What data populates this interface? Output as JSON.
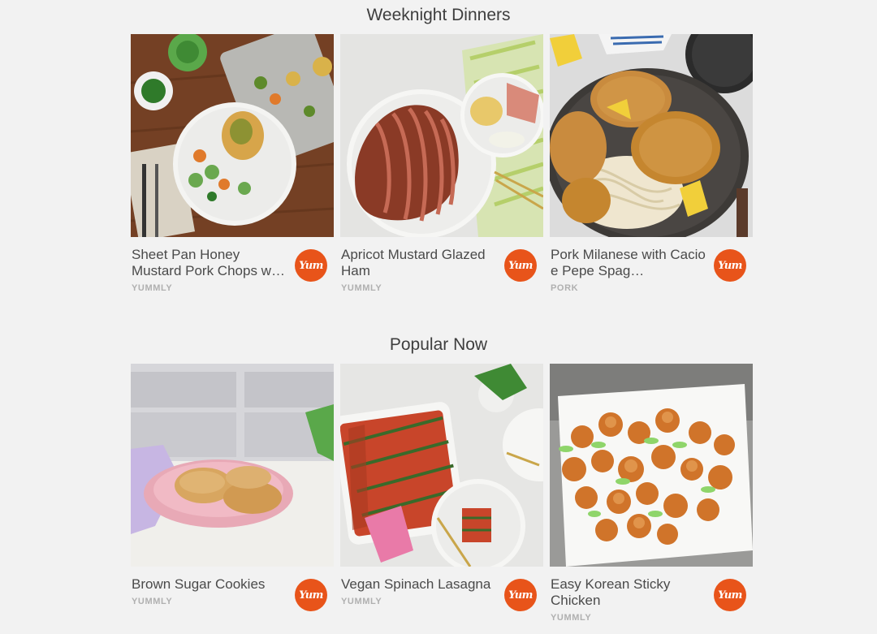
{
  "sections": [
    {
      "title": "Weeknight Dinners",
      "cards": [
        {
          "name": "Sheet Pan Honey Mustard Pork Chops w…",
          "source": "YUMMLY",
          "image": "pork-chops-sheet-pan-photo"
        },
        {
          "name": "Apricot Mustard Glazed Ham",
          "source": "YUMMLY",
          "image": "glazed-ham-photo"
        },
        {
          "name": "Pork Milanese with Cacio e Pepe Spag…",
          "source": "PORK",
          "image": "pork-milanese-photo"
        }
      ]
    },
    {
      "title": "Popular Now",
      "cards": [
        {
          "name": "Brown Sugar Cookies",
          "source": "YUMMLY",
          "image": "cookies-photo"
        },
        {
          "name": "Vegan Spinach Lasagna",
          "source": "YUMMLY",
          "image": "lasagna-photo"
        },
        {
          "name": "Easy Korean Sticky Chicken",
          "source": "YUMMLY",
          "image": "sticky-chicken-photo"
        }
      ]
    }
  ],
  "badge": {
    "label": "Yum",
    "color": "#e8541a"
  }
}
